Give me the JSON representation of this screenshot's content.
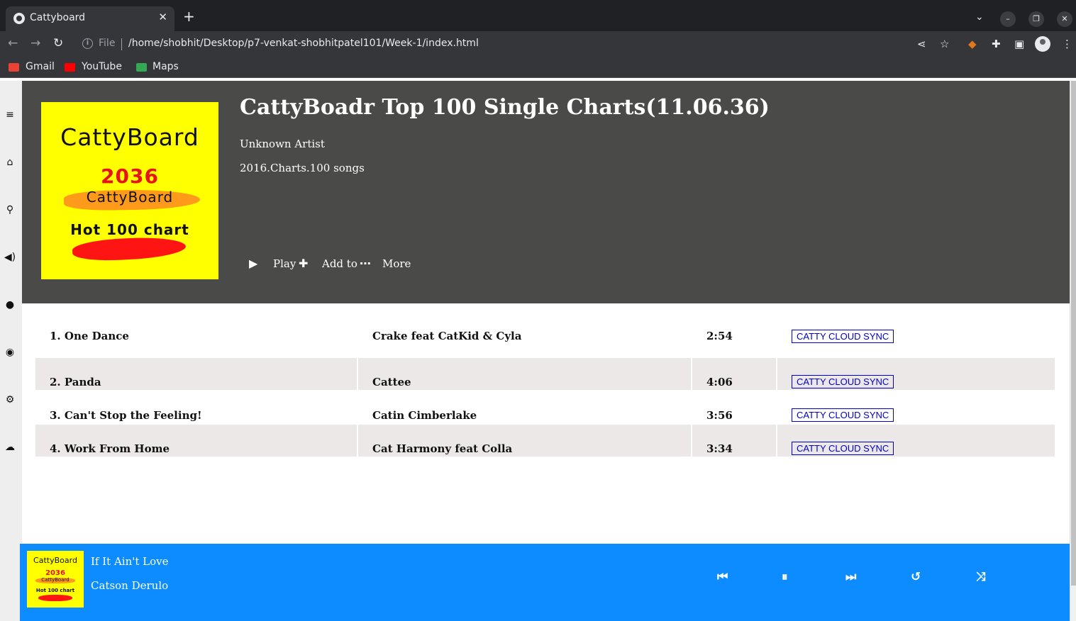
{
  "browser": {
    "tab_title": "Cattyboard",
    "new_tab": "+",
    "tab_close": "✕",
    "scheme": "File",
    "url": "/home/shobhit/Desktop/p7-venkat-shobhitpatel101/Week-1/index.html",
    "bookmarks": [
      {
        "label": "Gmail",
        "color": "#ea4335"
      },
      {
        "label": "YouTube",
        "color": "#ff0000"
      },
      {
        "label": "Maps",
        "color": "#34a853"
      }
    ]
  },
  "album": {
    "title": "CattyBoadr Top 100 Single Charts(11.06.36)",
    "artist": "Unknown Artist",
    "meta": "2016.Charts.100 songs",
    "cover": {
      "title": "CattyBoard",
      "year": "2036",
      "subtitle": "CattyBoard",
      "hot": "Hot 100 chart"
    },
    "actions": {
      "play": "Play",
      "add": "Add to",
      "more": "More"
    }
  },
  "tracks": [
    {
      "title": "1. One Dance",
      "artist": "Crake feat CatKid & Cyla",
      "duration": "2:54",
      "sync": "CATTY CLOUD SYNC"
    },
    {
      "title": "2. Panda",
      "artist": "Cattee",
      "duration": "4:06",
      "sync": "CATTY CLOUD SYNC"
    },
    {
      "title": "3. Can't Stop the Feeling!",
      "artist": "Catin Cimberlake",
      "duration": "3:56",
      "sync": "CATTY CLOUD SYNC"
    },
    {
      "title": "4. Work From Home",
      "artist": "Cat Harmony feat Colla",
      "duration": "3:34",
      "sync": "CATTY CLOUD SYNC"
    }
  ],
  "now_playing": {
    "title": "If It Ain't Love",
    "artist": "Catson Derulo",
    "cover": {
      "title": "CattyBoard",
      "year": "2036",
      "subtitle": "CattyBoard",
      "hot": "Hot 100 chart"
    }
  },
  "colors": {
    "header_bg": "#4a4b49",
    "player_bg": "#0c8cff",
    "cover_bg": "#ffff00",
    "alt_row": "#ece8e7",
    "sync_border": "#0000cc"
  }
}
